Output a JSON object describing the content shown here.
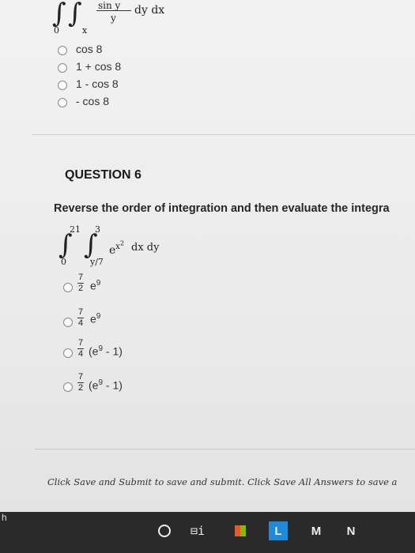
{
  "previous_question": {
    "integral": {
      "upper_outer": "",
      "lower_outer": "0",
      "lower_inner": "x",
      "integrand_num": "sin y",
      "integrand_den": "y",
      "differentials": "dy dx"
    },
    "options": [
      "cos 8",
      "1 + cos 8",
      "1 - cos 8",
      "- cos 8"
    ]
  },
  "question": {
    "title": "QUESTION 6",
    "prompt": "Reverse the order of integration and then evaluate the integra",
    "integral": {
      "upper_outer": "21",
      "lower_outer": "0",
      "upper_inner": "3",
      "lower_inner": "y/7",
      "integrand": "e",
      "exponent": "x",
      "exponent_power": "2",
      "differentials": "dx dy"
    },
    "options": [
      {
        "num": "7",
        "den": "2",
        "expr": "e",
        "power": "9",
        "tail": ""
      },
      {
        "num": "7",
        "den": "4",
        "expr": "e",
        "power": "9",
        "tail": ""
      },
      {
        "num": "7",
        "den": "4",
        "expr": "(e",
        "power": "9",
        "tail": " - 1)"
      },
      {
        "num": "7",
        "den": "2",
        "expr": "(e",
        "power": "9",
        "tail": " - 1)"
      }
    ]
  },
  "footer": {
    "note": "Click Save and Submit to save and submit. Click Save All Answers to save a"
  },
  "taskbar": {
    "left_fragment": "h",
    "taskview_label": "⊟i",
    "l_app": "L",
    "mail_app": "M",
    "n_app": "N"
  }
}
